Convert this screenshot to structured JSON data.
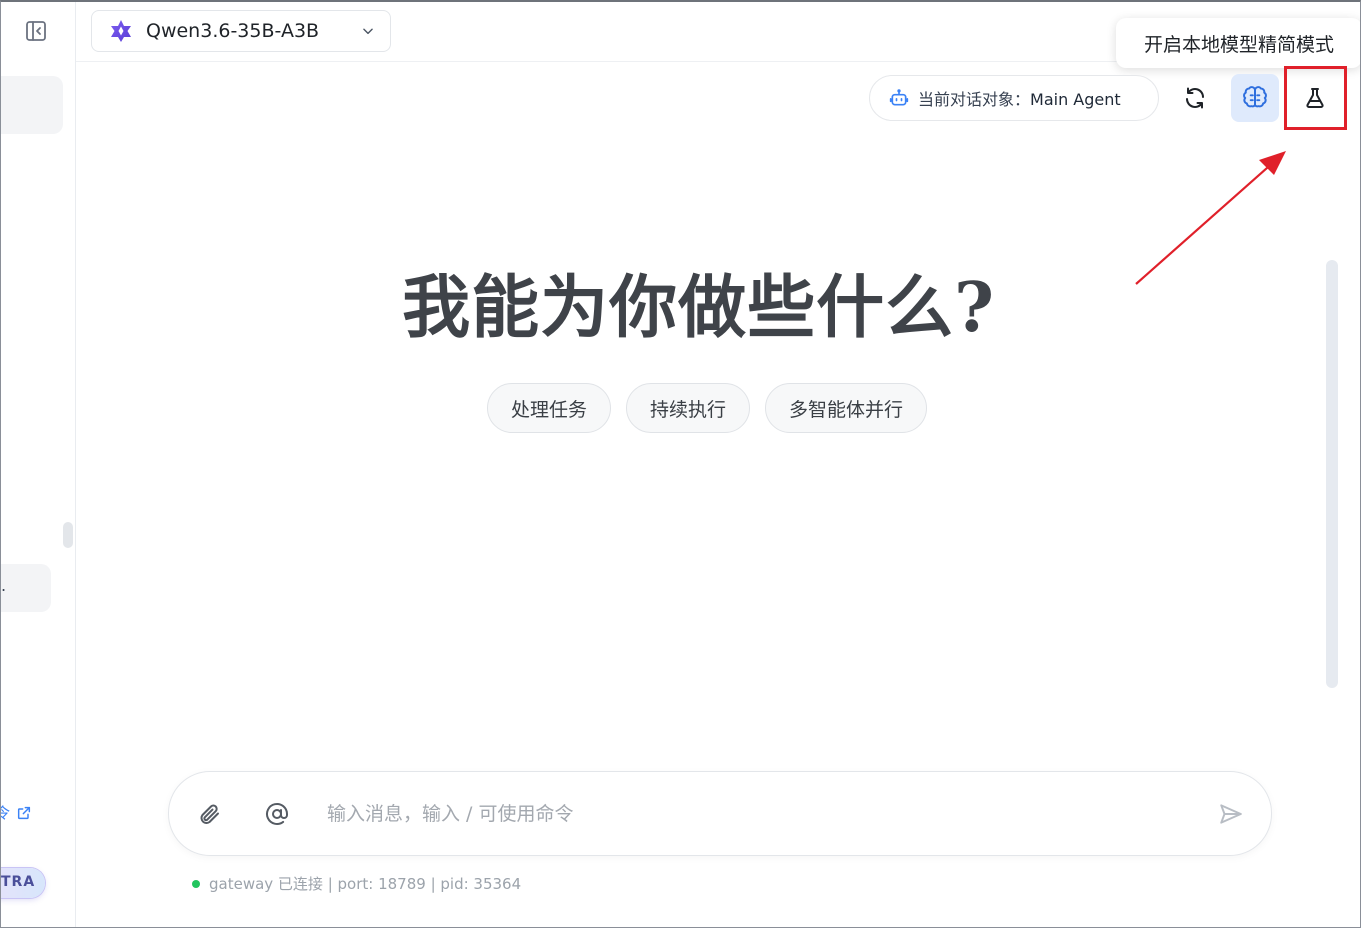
{
  "sidebar": {
    "item_text": ".",
    "link_text": "令",
    "badge_text": "TRA"
  },
  "header": {
    "model_name": "Qwen3.6-35B-A3B"
  },
  "tooltip": {
    "text": "开启本地模型精简模式"
  },
  "toolbar": {
    "agent_prefix": "当前对话对象：",
    "agent_name": "Main Agent"
  },
  "main": {
    "hero_title": "我能为你做些什么?",
    "chips": [
      "处理任务",
      "持续执行",
      "多智能体并行"
    ]
  },
  "composer": {
    "placeholder": "输入消息，输入 / 可使用命令",
    "value": ""
  },
  "status": {
    "text": "gateway 已连接 | port: 18789 | pid: 35364",
    "color": "#22c55e"
  },
  "colors": {
    "accent": "#3b82f6",
    "highlight": "#e0202a",
    "brain_bg": "#dfeafc"
  },
  "icons": [
    "sidebar-collapse-icon",
    "qwen-logo-icon",
    "chevron-down-icon",
    "robot-icon",
    "refresh-icon",
    "brain-icon",
    "flask-icon",
    "paperclip-icon",
    "at-icon",
    "send-icon",
    "external-link-icon"
  ]
}
